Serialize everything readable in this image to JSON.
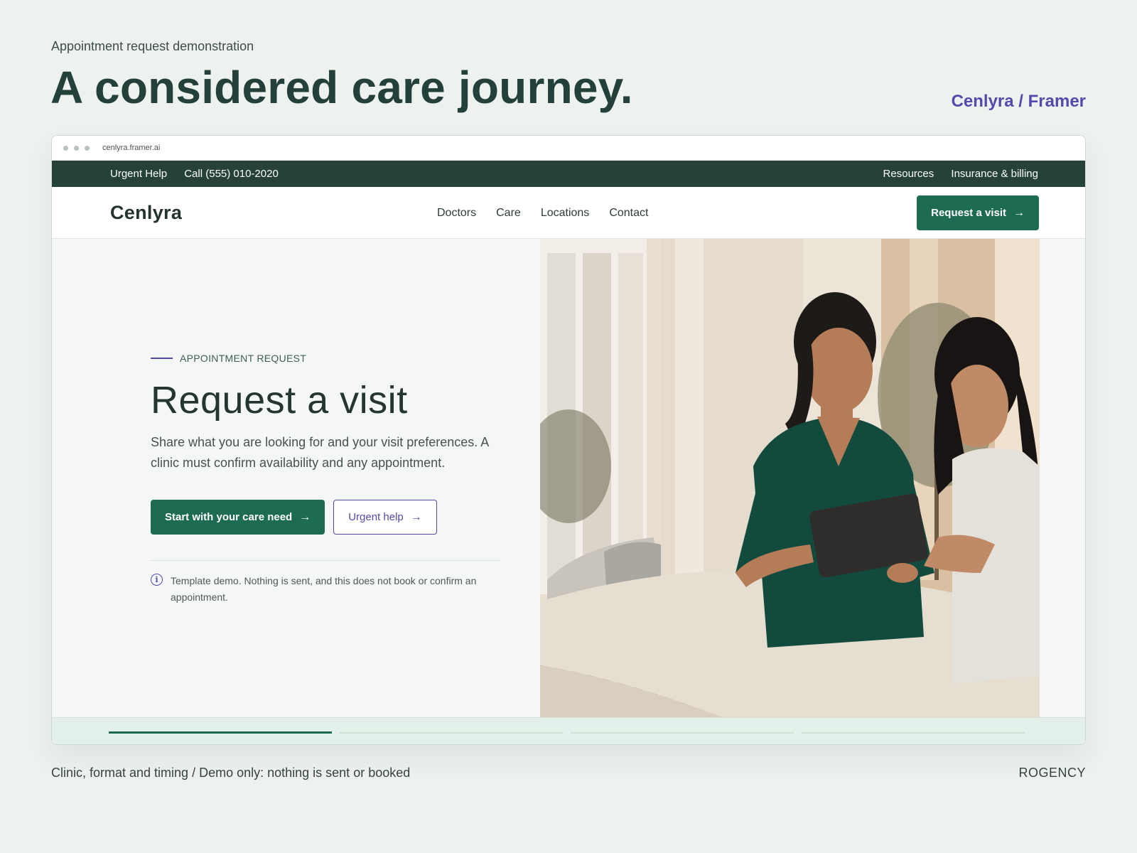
{
  "page": {
    "eyebrow": "Appointment request demonstration",
    "title": "A considered care journey.",
    "credit": "Cenlyra / Framer",
    "footer_left": "Clinic, format and timing / Demo only: nothing is sent or booked",
    "footer_right": "ROGENCY"
  },
  "browser": {
    "url": "cenlyra.framer.ai"
  },
  "topbar": {
    "urgent": "Urgent Help",
    "phone": "Call (555) 010-2020",
    "resources": "Resources",
    "insurance": "Insurance & billing"
  },
  "nav": {
    "logo": "Cenlyra",
    "links": [
      "Doctors",
      "Care",
      "Locations",
      "Contact"
    ],
    "cta": "Request a visit"
  },
  "hero": {
    "eyebrow": "APPOINTMENT REQUEST",
    "title": "Request a visit",
    "subtitle": "Share what you are looking for and your visit preferences. A clinic must confirm availability and any appointment.",
    "primary_cta": "Start with your care need",
    "secondary_cta": "Urgent help",
    "notice": "Template demo. Nothing is sent, and this does not book or confirm an appointment."
  },
  "progress": {
    "steps": 4,
    "active": 1
  },
  "icons": {
    "arrow": "arrow-right-icon",
    "info": "info-icon",
    "window_dots": "window-dots-icon"
  },
  "colors": {
    "brand_green": "#1d6b52",
    "dark_green": "#25413a",
    "accent_purple": "#5649ad",
    "page_bg": "#edf2ef"
  }
}
